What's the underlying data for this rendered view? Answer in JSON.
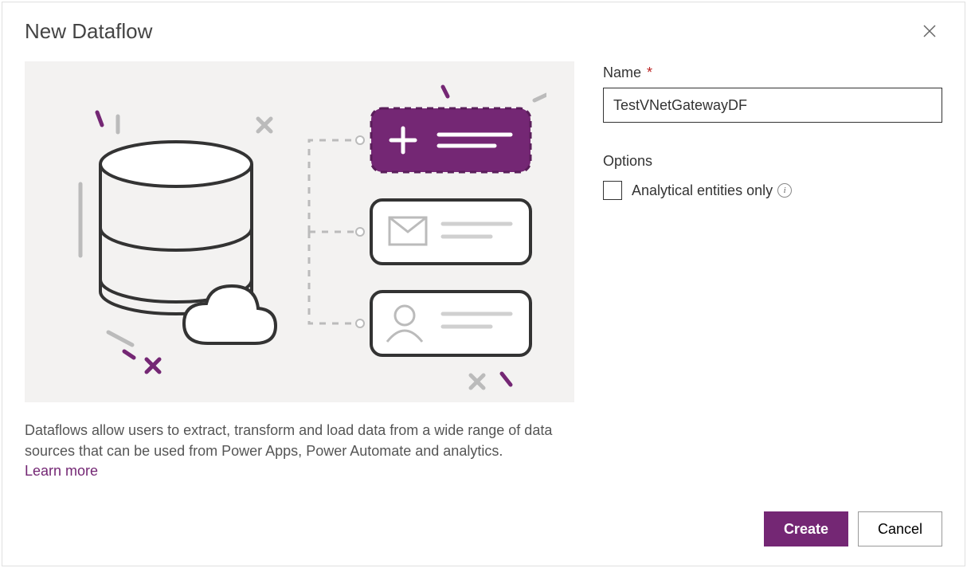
{
  "dialog": {
    "title": "New Dataflow",
    "description": "Dataflows allow users to extract, transform and load data from a wide range of data sources that can be used from Power Apps, Power Automate and analytics.",
    "learn_more_label": "Learn more"
  },
  "form": {
    "name_label": "Name",
    "name_required": "*",
    "name_value": "TestVNetGatewayDF",
    "options_heading": "Options",
    "analytical_checkbox_label": "Analytical entities only",
    "analytical_checked": false
  },
  "footer": {
    "create_label": "Create",
    "cancel_label": "Cancel"
  },
  "colors": {
    "accent": "#742774",
    "illustration_bg": "#f3f2f1"
  }
}
